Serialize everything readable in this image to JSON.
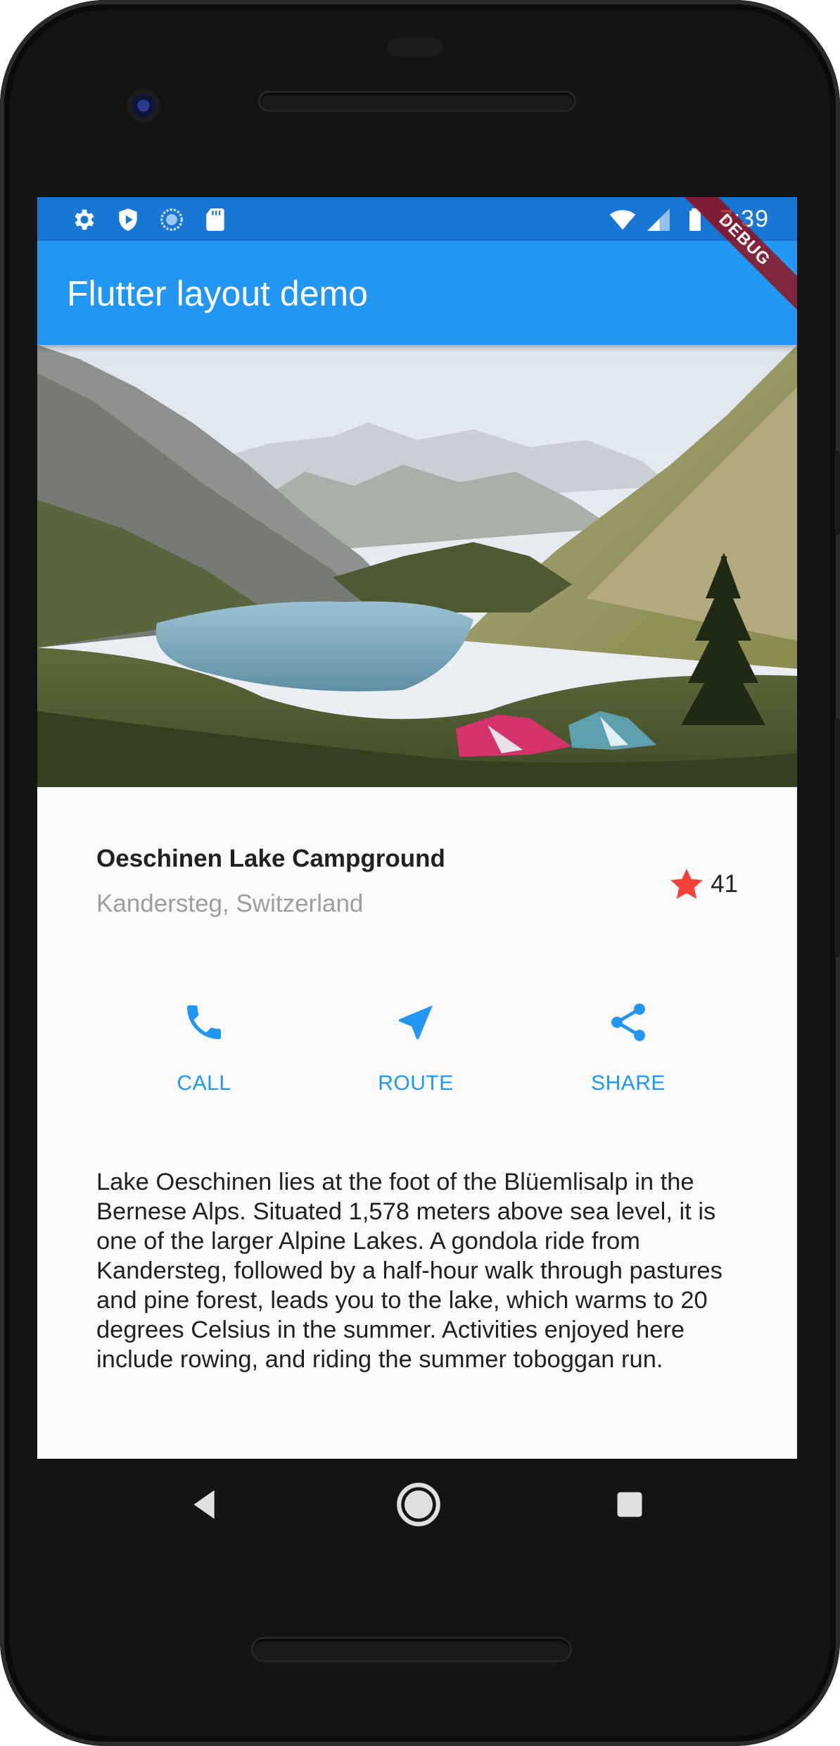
{
  "status_bar": {
    "time": "7:39",
    "left_icons": [
      "settings-icon",
      "play-protect-icon",
      "sync-circle-icon",
      "sd-card-icon"
    ],
    "right_icons": [
      "wifi-icon",
      "signal-icon",
      "battery-icon"
    ],
    "color": "#1976d2"
  },
  "app_bar": {
    "title": "Flutter layout demo",
    "color": "#2196f3"
  },
  "debug_banner": {
    "label": "DEBUG"
  },
  "hero_image": {
    "description_icon": "lake-mountain-campground-photo"
  },
  "title_section": {
    "name": "Oeschinen Lake Campground",
    "location": "Kandersteg, Switzerland",
    "rating_icon": "star-icon",
    "rating_count": "41",
    "star_color": "#f44336"
  },
  "button_section": {
    "accent": "#2196f3",
    "buttons": [
      {
        "label": "CALL",
        "icon": "phone-icon"
      },
      {
        "label": "ROUTE",
        "icon": "navigation-icon"
      },
      {
        "label": "SHARE",
        "icon": "share-icon"
      }
    ]
  },
  "description": {
    "text": "Lake Oeschinen lies at the foot of the Blüemlisalp in the Bernese Alps. Situated 1,578 meters above sea level, it is one of the larger Alpine Lakes. A gondola ride from Kandersteg, followed by a half-hour walk through pastures and pine forest, leads you to the lake, which warms to 20 degrees Celsius in the summer. Activities enjoyed here include rowing, and riding the summer toboggan run."
  },
  "nav_bar": {
    "buttons": [
      "back-icon",
      "home-icon",
      "recents-icon"
    ]
  }
}
